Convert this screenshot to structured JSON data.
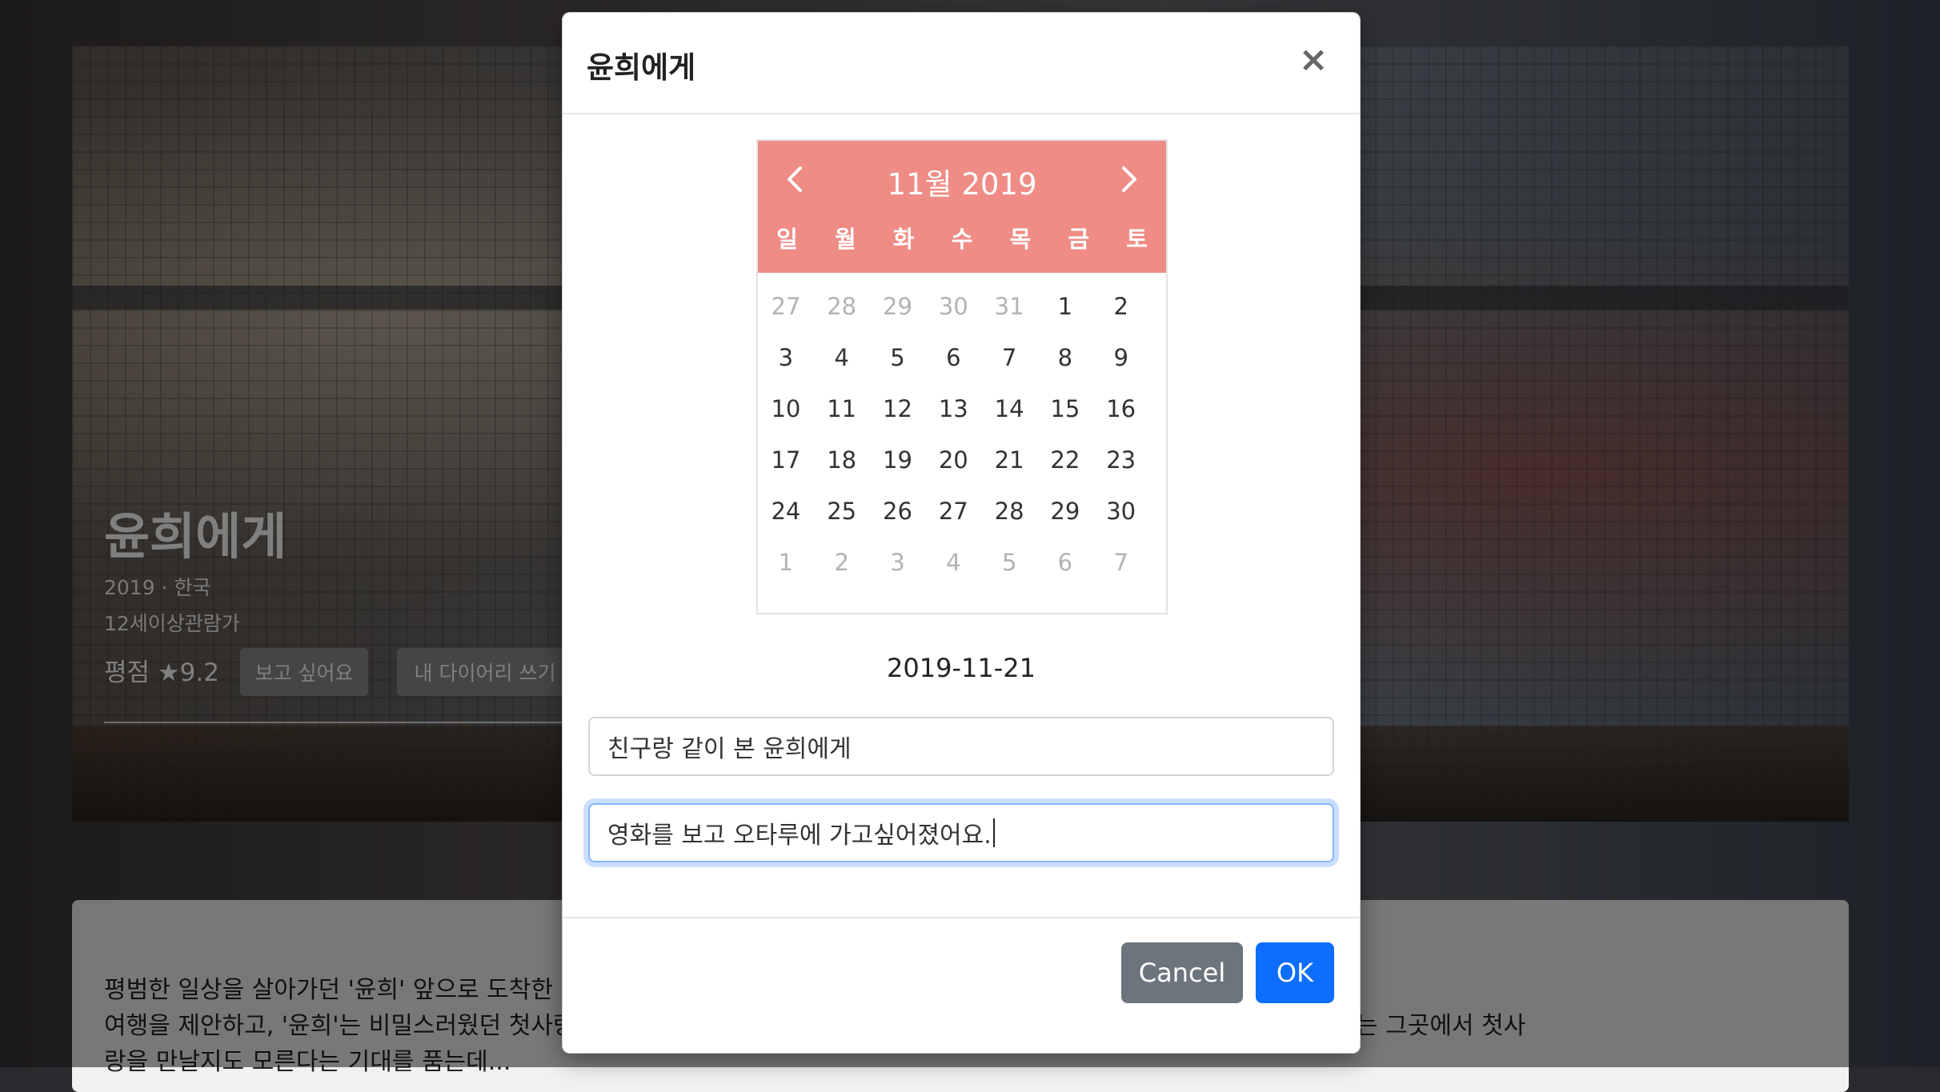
{
  "background_page": {
    "movie_title": "윤희에게",
    "year_country": "2019 · 한국",
    "age_rating": "12세이상관람가",
    "score": "평점 ★9.2",
    "want_button": "보고 싶어요",
    "diary_button": "내 다이어리 쓰기",
    "description_line1": "평범한 일상을 살아가던 '윤희' 앞으로 도착한 '                                                                                                                                    고 있는 곳으로",
    "description_line2": "여행을 제안하고, '윤희'는 비밀스러웠던 첫사랑의 기억으로 가슴이 뛴다. '새봄'과 함께 여행을 떠난 '윤희'는 끝없이 눈이 내리는 그곳에서 첫사",
    "description_line3": "랑을 만날지도 모른다는 기대를 품는데..."
  },
  "modal": {
    "title": "윤희에게",
    "close_label": "×",
    "calendar": {
      "prev_label": "‹",
      "next_label": "›",
      "month_label": "11월 2019",
      "weekdays": [
        "일",
        "월",
        "화",
        "수",
        "목",
        "금",
        "토"
      ],
      "days": [
        {
          "label": "27",
          "muted": true
        },
        {
          "label": "28",
          "muted": true
        },
        {
          "label": "29",
          "muted": true
        },
        {
          "label": "30",
          "muted": true
        },
        {
          "label": "31",
          "muted": true
        },
        {
          "label": "1",
          "muted": false
        },
        {
          "label": "2",
          "muted": false
        },
        {
          "label": "3",
          "muted": false
        },
        {
          "label": "4",
          "muted": false
        },
        {
          "label": "5",
          "muted": false
        },
        {
          "label": "6",
          "muted": false
        },
        {
          "label": "7",
          "muted": false
        },
        {
          "label": "8",
          "muted": false
        },
        {
          "label": "9",
          "muted": false
        },
        {
          "label": "10",
          "muted": false
        },
        {
          "label": "11",
          "muted": false
        },
        {
          "label": "12",
          "muted": false
        },
        {
          "label": "13",
          "muted": false
        },
        {
          "label": "14",
          "muted": false
        },
        {
          "label": "15",
          "muted": false
        },
        {
          "label": "16",
          "muted": false
        },
        {
          "label": "17",
          "muted": false
        },
        {
          "label": "18",
          "muted": false
        },
        {
          "label": "19",
          "muted": false
        },
        {
          "label": "20",
          "muted": false
        },
        {
          "label": "21",
          "muted": false
        },
        {
          "label": "22",
          "muted": false
        },
        {
          "label": "23",
          "muted": false
        },
        {
          "label": "24",
          "muted": false
        },
        {
          "label": "25",
          "muted": false
        },
        {
          "label": "26",
          "muted": false
        },
        {
          "label": "27",
          "muted": false
        },
        {
          "label": "28",
          "muted": false
        },
        {
          "label": "29",
          "muted": false
        },
        {
          "label": "30",
          "muted": false
        },
        {
          "label": "1",
          "muted": true
        },
        {
          "label": "2",
          "muted": true
        },
        {
          "label": "3",
          "muted": true
        },
        {
          "label": "4",
          "muted": true
        },
        {
          "label": "5",
          "muted": true
        },
        {
          "label": "6",
          "muted": true
        },
        {
          "label": "7",
          "muted": true
        }
      ]
    },
    "selected_date": "2019-11-21",
    "title_field_value": "친구랑 같이 본 윤희에게",
    "body_field_value": "영화를 보고 오타루에 가고싶어졌어요.",
    "cancel_label": "Cancel",
    "ok_label": "OK"
  },
  "colors": {
    "calendar_header": "#ef8c86",
    "ok_button": "#0d6efd",
    "cancel_button": "#6c757d",
    "focus_ring": "#86b7fe"
  }
}
